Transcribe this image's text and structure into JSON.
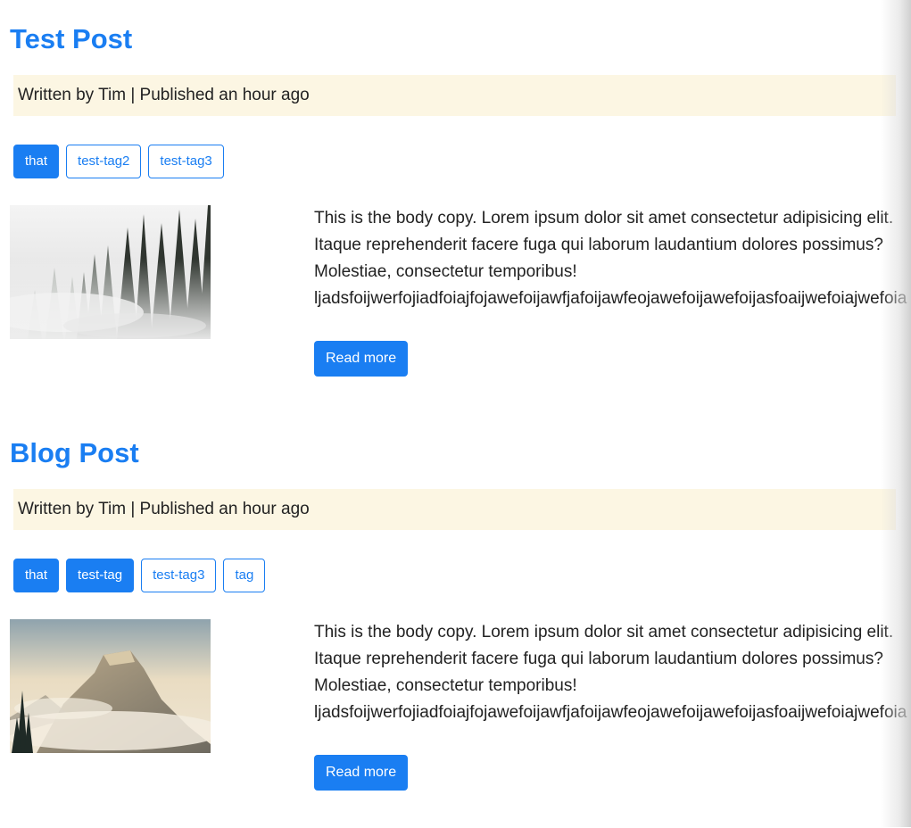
{
  "posts": [
    {
      "title": "Test Post",
      "meta": "Written by Tim | Published an hour ago",
      "tags": [
        {
          "label": "that",
          "active": true
        },
        {
          "label": "test-tag2",
          "active": false
        },
        {
          "label": "test-tag3",
          "active": false
        }
      ],
      "image": "foggy-forest",
      "body_lines": [
        "This is the body copy. Lorem ipsum dolor sit amet consectetur adipisicing elit.",
        "Itaque reprehenderit facere fuga qui laborum laudantium dolores possimus?",
        "Molestiae, consectetur temporibus!",
        "ljadsfoijwerfojiadfoiajfojawefoijawfjafoijawfeojawefoijawefoijasfoaijwefoiajwefoia"
      ],
      "button_label": "Read more"
    },
    {
      "title": "Blog Post",
      "meta": "Written by Tim | Published an hour ago",
      "tags": [
        {
          "label": "that",
          "active": true
        },
        {
          "label": "test-tag",
          "active": true
        },
        {
          "label": "test-tag3",
          "active": false
        },
        {
          "label": "tag",
          "active": false
        }
      ],
      "image": "misty-mountain",
      "body_lines": [
        "This is the body copy. Lorem ipsum dolor sit amet consectetur adipisicing elit.",
        "Itaque reprehenderit facere fuga qui laborum laudantium dolores possimus?",
        "Molestiae, consectetur temporibus!",
        "ljadsfoijwerfojiadfoiajfojawefoijawfjafoijawfeojawefoijawefoijasfoaijwefoiajwefoia"
      ],
      "button_label": "Read more"
    }
  ],
  "colors": {
    "accent": "#1a7ef2",
    "meta_background": "#fcf6e3",
    "text": "#222222"
  }
}
